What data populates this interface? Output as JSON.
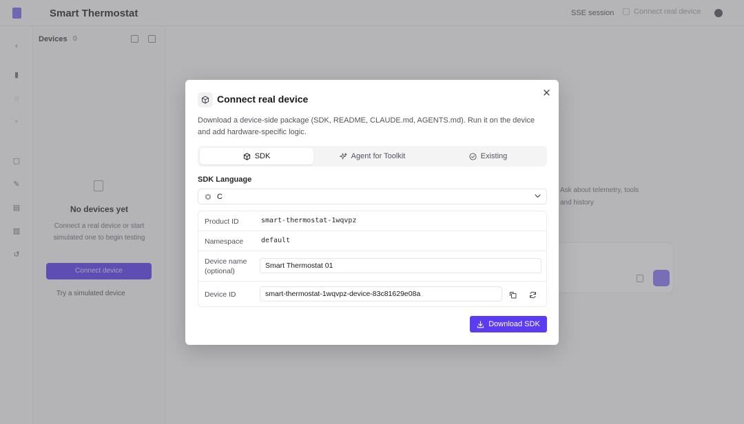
{
  "app": {
    "title": "Smart Thermostat",
    "top_right_text": "SSE session",
    "top_right_button": "Connect real device"
  },
  "sidebar": {
    "heading": "Devices",
    "badge": "0",
    "empty_title": "No devices yet",
    "empty_description": "Connect a real device or start simulated one to begin testing",
    "cta_label": "Connect device",
    "link_label": "Try a simulated device"
  },
  "main": {
    "hint_line_1": "Ask about telemetry, tools",
    "hint_line_2": "and history"
  },
  "modal": {
    "title": "Connect real device",
    "description": "Download a device-side package (SDK, README, CLAUDE.md, AGENTS.md). Run it on the device and add hardware-specific logic.",
    "tabs": [
      {
        "label": "SDK",
        "icon": "package-icon",
        "active": true
      },
      {
        "label": "Agent for Toolkit",
        "icon": "sparkles-icon",
        "active": false
      },
      {
        "label": "Existing",
        "icon": "check-circle-icon",
        "active": false
      }
    ],
    "sdk_language_label": "SDK Language",
    "sdk_language_value": "C",
    "fields": {
      "product_id_label": "Product ID",
      "product_id_value": "smart-thermostat-1wqvpz",
      "namespace_label": "Namespace",
      "namespace_value": "default",
      "device_name_label": "Device name (optional)",
      "device_name_value": "Smart Thermostat 01",
      "device_id_label": "Device ID",
      "device_id_value": "smart-thermostat-1wqvpz-device-83c81629e08a"
    },
    "download_button": "Download SDK"
  },
  "colors": {
    "accent": "#5b3cf0",
    "overlay": "#626268"
  }
}
